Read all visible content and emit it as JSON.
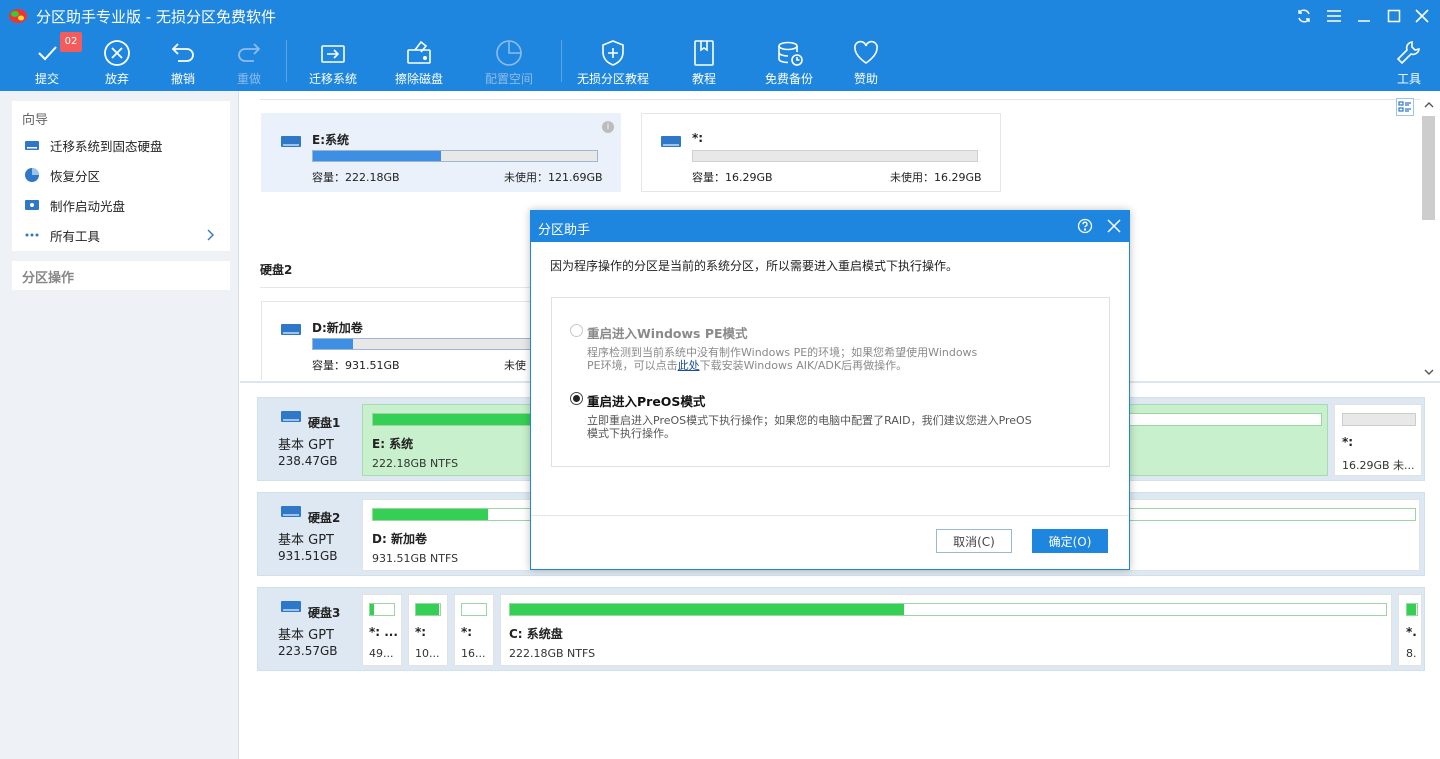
{
  "app": {
    "title": "分区助手专业版 - 无损分区免费软件",
    "pending_count": "02"
  },
  "toolbar": {
    "commit": "提交",
    "discard": "放弃",
    "undo": "撤销",
    "redo": "重做",
    "migrate": "迁移系统",
    "wipe": "擦除磁盘",
    "allocate": "配置空间",
    "tutorial_lossless": "无损分区教程",
    "tutorial": "教程",
    "backup": "免费备份",
    "sponsor": "赞助",
    "tools": "工具"
  },
  "sidebar": {
    "wizard_title": "向导",
    "items": [
      {
        "label": "迁移系统到固态硬盘",
        "icon": "ssd-icon"
      },
      {
        "label": "恢复分区",
        "icon": "recover-icon"
      },
      {
        "label": "制作启动光盘",
        "icon": "disc-icon"
      },
      {
        "label": "所有工具",
        "icon": "dots-icon"
      }
    ],
    "partition_ops_title": "分区操作"
  },
  "cards": {
    "e": {
      "name": "E:系统",
      "capacity": "容量：222.18GB",
      "free": "未使用：121.69GB",
      "used_fraction": 0.45
    },
    "star": {
      "name": "*:",
      "capacity": "容量：16.29GB",
      "free": "未使用：16.29GB",
      "used_fraction": 0.0
    },
    "disk2_title": "硬盘2",
    "d": {
      "name": "D:新加卷",
      "capacity": "容量：931.51GB",
      "free_partial": "未使",
      "used_fraction": 0.14
    }
  },
  "disks": [
    {
      "name": "硬盘1",
      "type": "基本 GPT",
      "size": "238.47GB",
      "partitions": [
        {
          "name": "E: 系统",
          "info": "222.18GB NTFS",
          "used_fraction": 0.45
        },
        {
          "name": "*:",
          "info": "16.29GB 未...",
          "used_fraction": 0.0
        }
      ]
    },
    {
      "name": "硬盘2",
      "type": "基本 GPT",
      "size": "931.51GB",
      "partitions": [
        {
          "name": "D: 新加卷",
          "info": "931.51GB NTFS",
          "used_fraction": 0.11
        }
      ]
    },
    {
      "name": "硬盘3",
      "type": "基本 GPT",
      "size": "223.57GB",
      "partitions": [
        {
          "name": "*: ...",
          "info": "49...",
          "used_fraction": 0.15
        },
        {
          "name": "*:",
          "info": "10...",
          "used_fraction": 0.95
        },
        {
          "name": "*:",
          "info": "16...",
          "used_fraction": 0.0
        },
        {
          "name": "C: 系统盘",
          "info": "222.18GB NTFS",
          "used_fraction": 0.45
        },
        {
          "name": "*.",
          "info": "8.",
          "used_fraction": 0.9
        }
      ]
    }
  ],
  "dialog": {
    "title": "分区助手",
    "message": "因为程序操作的分区是当前的系统分区，所以需要进入重启模式下执行操作。",
    "option_pe": {
      "label": "重启进入Windows PE模式",
      "desc_line1": "程序检测到当前系统中没有制作Windows PE的环境；如果您希望使用Windows",
      "desc_line2_pre": "PE环境，可以点击",
      "desc_line2_link": "此处",
      "desc_line2_post": "下载安装Windows AIK/ADK后再做操作。"
    },
    "option_preos": {
      "label": "重启进入PreOS模式",
      "desc_line1": "立即重启进入PreOS模式下执行操作；如果您的电脑中配置了RAID，我们建议您进入PreOS",
      "desc_line2": "模式下执行操作。"
    },
    "selected_option": "preos",
    "cancel": "取消(C)",
    "ok": "确定(O)"
  }
}
